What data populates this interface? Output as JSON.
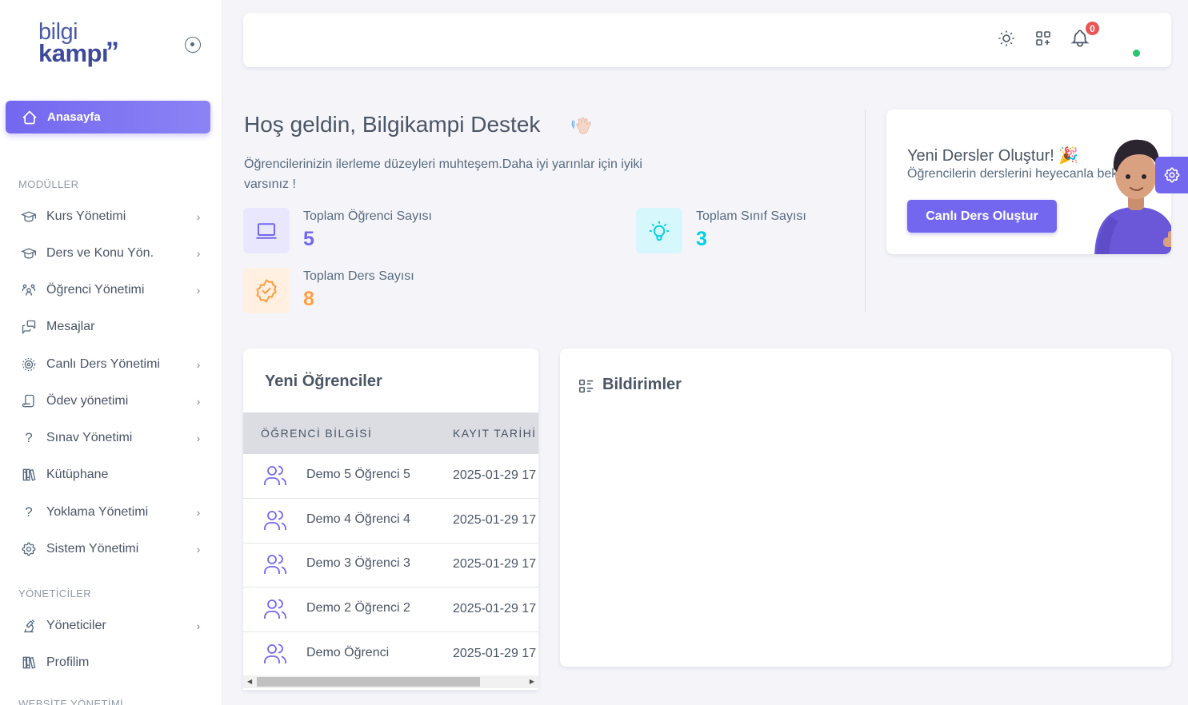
{
  "brand": {
    "line1": "bilgi",
    "line2": "kampı",
    "quote_mark": "”"
  },
  "sidebar": {
    "active": {
      "label": "Anasayfa",
      "icon": "home-icon"
    },
    "section_modules": "MODÜLLER",
    "modules": [
      {
        "label": "Kurs Yönetimi",
        "icon": "graduation-cap-icon",
        "has_children": true
      },
      {
        "label": "Ders ve Konu Yön.",
        "icon": "graduation-cap-icon",
        "has_children": true
      },
      {
        "label": "Öğrenci Yönetimi",
        "icon": "users-group-icon",
        "has_children": true
      },
      {
        "label": "Mesajlar",
        "icon": "message-icon",
        "has_children": false
      },
      {
        "label": "Canlı Ders Yönetimi",
        "icon": "live-broadcast-icon",
        "has_children": true
      },
      {
        "label": "Ödev yönetimi",
        "icon": "notebook-icon",
        "has_children": true
      },
      {
        "label": "Sınav Yönetimi",
        "icon": "question-icon",
        "has_children": true
      },
      {
        "label": "Kütüphane",
        "icon": "books-icon",
        "has_children": false
      },
      {
        "label": "Yoklama Yönetimi",
        "icon": "question-icon",
        "has_children": true
      },
      {
        "label": "Sistem Yönetimi",
        "icon": "gear-icon",
        "has_children": true
      }
    ],
    "section_admins": "YÖNETİCİLER",
    "admins": [
      {
        "label": "Yöneticiler",
        "icon": "microscope-icon",
        "has_children": true
      },
      {
        "label": "Profilim",
        "icon": "books-icon",
        "has_children": false
      }
    ],
    "section_website": "WEBSİTE YÖNETİMİ"
  },
  "topbar": {
    "notification_count": "0",
    "icons": [
      "sun-icon",
      "apps-add-icon",
      "bell-icon"
    ]
  },
  "welcome": {
    "title": "Hoş geldin, Bilgikampi Destek",
    "subtitle": "Öğrencilerinizin ilerleme düzeyleri muhteşem.Daha iyi yarınlar için iyiki varsınız !",
    "stats": [
      {
        "label": "Toplam Öğrenci Sayısı",
        "value": "5",
        "color": "#7367f0",
        "bg": "#e9e7fd",
        "icon": "laptop-icon"
      },
      {
        "label": "Toplam Sınıf Sayısı",
        "value": "3",
        "color": "#00cfe8",
        "bg": "#d6f7fb",
        "icon": "lightbulb-icon"
      },
      {
        "label": "Toplam Ders Sayısı",
        "value": "8",
        "color": "#ff9f43",
        "bg": "#fff0e1",
        "icon": "badge-check-icon"
      }
    ]
  },
  "promo": {
    "title": "Yeni Dersler Oluştur! 🎉",
    "subtitle": "Öğrencilerin derslerini heyecanla bekliyor",
    "button": "Canlı Ders Oluştur"
  },
  "students": {
    "title": "Yeni Öğrenciler",
    "columns": [
      "ÖĞRENCİ BİLGİSİ",
      "KAYIT TARİHİ"
    ],
    "rows": [
      {
        "name": "Demo 5 Öğrenci 5",
        "date": "2025-01-29 17"
      },
      {
        "name": "Demo 4 Öğrenci 4",
        "date": "2025-01-29 17"
      },
      {
        "name": "Demo 3 Öğrenci 3",
        "date": "2025-01-29 17"
      },
      {
        "name": "Demo 2 Öğrenci 2",
        "date": "2025-01-29 17"
      },
      {
        "name": "Demo Öğrenci",
        "date": "2025-01-29 17"
      }
    ]
  },
  "notifications": {
    "title": "Bildirimler"
  },
  "colors": {
    "primary": "#7367f0",
    "success": "#28c76f",
    "danger": "#ea5455",
    "info": "#00cfe8",
    "warning": "#ff9f43"
  }
}
